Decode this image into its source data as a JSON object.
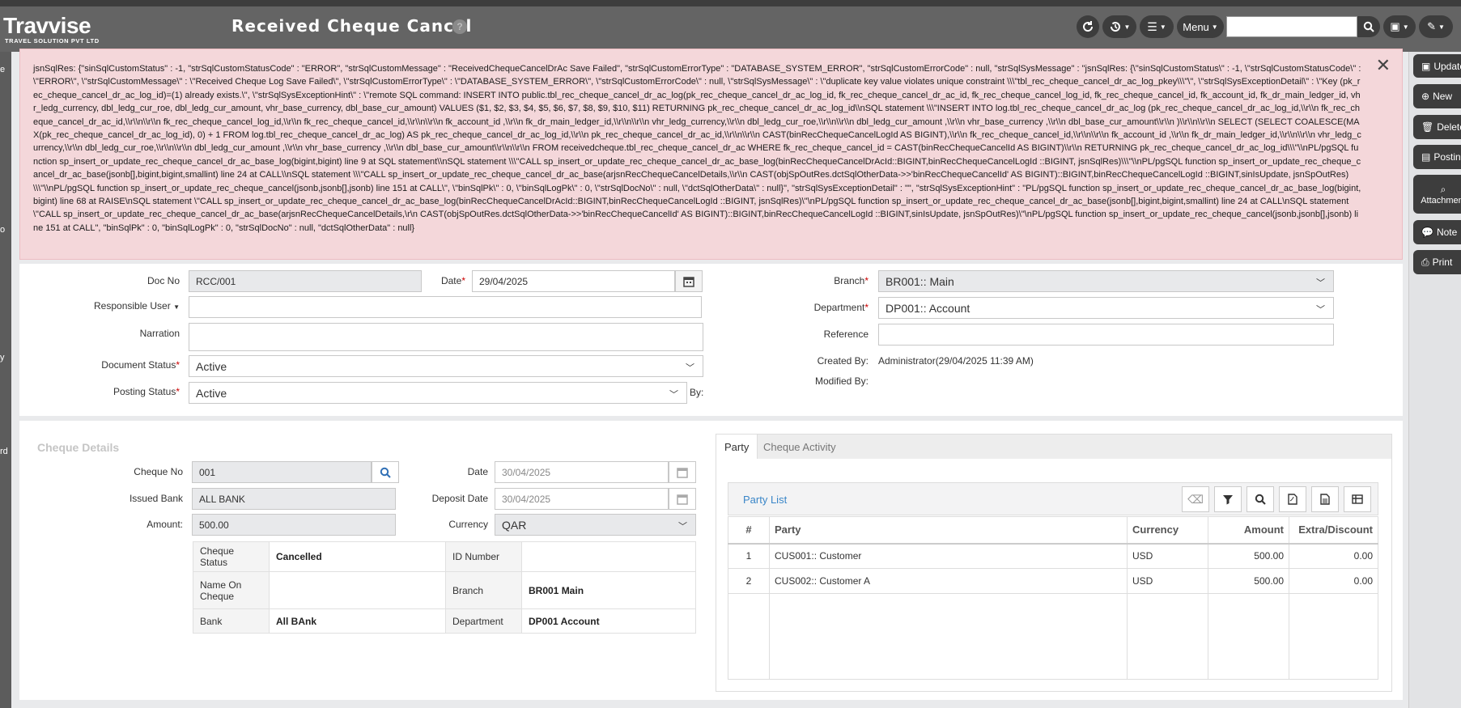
{
  "app": {
    "logo_main": "Travvise",
    "logo_sub": "TRAVEL SOLUTION PVT LTD"
  },
  "header": {
    "title": "Received Cheque Cancel",
    "help_icon": "?",
    "menu_label": "Menu",
    "search_placeholder": ""
  },
  "left_rail": {
    "items": [
      "e",
      "o",
      "y",
      "rd"
    ]
  },
  "right_rail": {
    "buttons": [
      {
        "label": "Update",
        "icon": "save-icon"
      },
      {
        "label": "New",
        "icon": "plus-icon"
      },
      {
        "label": "Delete",
        "icon": "trash-icon"
      },
      {
        "label": "Posting",
        "icon": "book-icon"
      },
      {
        "label": "Attachment",
        "icon": "paperclip-icon"
      },
      {
        "label": "Note",
        "icon": "comment-icon"
      },
      {
        "label": "Print",
        "icon": "print-icon"
      }
    ]
  },
  "error": {
    "message": "jsnSqlRes: {\"sinSqlCustomStatus\" : -1, \"strSqlCustomStatusCode\" : \"ERROR\", \"strSqlCustomMessage\" : \"ReceivedChequeCancelDrAc Save Failed\", \"strSqlCustomErrorType\" : \"DATABASE_SYSTEM_ERROR\", \"strSqlCustomErrorCode\" : null, \"strSqlSysMessage\" : \"jsnSqlRes: {\\\"sinSqlCustomStatus\\\" : -1, \\\"strSqlCustomStatusCode\\\" : \\\"ERROR\\\", \\\"strSqlCustomMessage\\\" : \\\"Received Cheque Log Save Failed\\\", \\\"strSqlCustomErrorType\\\" : \\\"DATABASE_SYSTEM_ERROR\\\", \\\"strSqlCustomErrorCode\\\" : null, \\\"strSqlSysMessage\\\" : \\\"duplicate key value violates unique constraint \\\\\\\"tbl_rec_cheque_cancel_dr_ac_log_pkey\\\\\\\"\\\", \\\"strSqlSysExceptionDetail\\\" : \\\"Key (pk_rec_cheque_cancel_dr_ac_log_id)=(1) already exists.\\\", \\\"strSqlSysExceptionHint\\\" : \\\"remote SQL command: INSERT INTO public.tbl_rec_cheque_cancel_dr_ac_log(pk_rec_cheque_cancel_dr_ac_log_id, fk_rec_cheque_cancel_dr_ac_id, fk_rec_cheque_cancel_log_id, fk_rec_cheque_cancel_id, fk_account_id, fk_dr_main_ledger_id, vhr_ledg_currency, dbl_ledg_cur_roe, dbl_ledg_cur_amount, vhr_base_currency, dbl_base_cur_amount) VALUES ($1, $2, $3, $4, $5, $6, $7, $8, $9, $10, $11) RETURNING pk_rec_cheque_cancel_dr_ac_log_id\\\\nSQL statement \\\\\\\"INSERT INTO log.tbl_rec_cheque_cancel_dr_ac_log (pk_rec_cheque_cancel_dr_ac_log_id,\\\\r\\\\n fk_rec_cheque_cancel_dr_ac_id,\\\\r\\\\n\\\\r\\\\n fk_rec_cheque_cancel_log_id,\\\\r\\\\n fk_rec_cheque_cancel_id,\\\\r\\\\n\\\\r\\\\n fk_account_id ,\\\\r\\\\n fk_dr_main_ledger_id,\\\\r\\\\n\\\\r\\\\n vhr_ledg_currency,\\\\r\\\\n dbl_ledg_cur_roe,\\\\r\\\\n\\\\r\\\\n dbl_ledg_cur_amount ,\\\\r\\\\n vhr_base_currency ,\\\\r\\\\n dbl_base_cur_amount\\\\r\\\\n )\\\\r\\\\n\\\\r\\\\n SELECT (SELECT COALESCE(MAX(pk_rec_cheque_cancel_dr_ac_log_id), 0) + 1 FROM log.tbl_rec_cheque_cancel_dr_ac_log) AS pk_rec_cheque_cancel_dr_ac_log_id,\\\\r\\\\n pk_rec_cheque_cancel_dr_ac_id,\\\\r\\\\n\\\\r\\\\n CAST(binRecChequeCancelLogId AS BIGINT),\\\\r\\\\n fk_rec_cheque_cancel_id,\\\\r\\\\n\\\\r\\\\n fk_account_id ,\\\\r\\\\n fk_dr_main_ledger_id,\\\\r\\\\n\\\\r\\\\n vhr_ledg_currency,\\\\r\\\\n dbl_ledg_cur_roe,\\\\r\\\\n\\\\r\\\\n dbl_ledg_cur_amount ,\\\\r\\\\n vhr_base_currency ,\\\\r\\\\n dbl_base_cur_amount\\\\r\\\\n\\\\r\\\\n FROM receivedcheque.tbl_rec_cheque_cancel_dr_ac WHERE fk_rec_cheque_cancel_id = CAST(binRecChequeCancelId AS BIGINT)\\\\r\\\\n RETURNING pk_rec_cheque_cancel_dr_ac_log_id\\\\\\\"\\\\nPL/pgSQL function sp_insert_or_update_rec_cheque_cancel_dr_ac_base_log(bigint,bigint) line 9 at SQL statement\\\\nSQL statement \\\\\\\"CALL sp_insert_or_update_rec_cheque_cancel_dr_ac_base_log(binRecChequeCancelDrAcId::BIGINT,binRecChequeCancelLogId ::BIGINT, jsnSqlRes)\\\\\\\"\\\\nPL/pgSQL function sp_insert_or_update_rec_cheque_cancel_dr_ac_base(jsonb[],bigint,bigint,smallint) line 24 at CALL\\\\nSQL statement \\\\\\\"CALL sp_insert_or_update_rec_cheque_cancel_dr_ac_base(arjsnRecChequeCancelDetails,\\\\r\\\\n CAST(objSpOutRes.dctSqlOtherData->>'binRecChequeCancelId' AS BIGINT)::BIGINT,binRecChequeCancelLogId ::BIGINT,sinIsUpdate, jsnSpOutRes)\\\\\\\"\\\\nPL/pgSQL function sp_insert_or_update_rec_cheque_cancel(jsonb,jsonb[],jsonb) line 151 at CALL\\\", \\\"binSqlPk\\\" : 0, \\\"binSqlLogPk\\\" : 0, \\\"strSqlDocNo\\\" : null, \\\"dctSqlOtherData\\\" : null}\", \"strSqlSysExceptionDetail\" : \"\", \"strSqlSysExceptionHint\" : \"PL/pgSQL function sp_insert_or_update_rec_cheque_cancel_dr_ac_base_log(bigint,bigint) line 68 at RAISE\\nSQL statement \\\"CALL sp_insert_or_update_rec_cheque_cancel_dr_ac_base_log(binRecChequeCancelDrAcId::BIGINT,binRecChequeCancelLogId ::BIGINT, jsnSqlRes)\\\"\\nPL/pgSQL function sp_insert_or_update_rec_cheque_cancel_dr_ac_base(jsonb[],bigint,bigint,smallint) line 24 at CALL\\nSQL statement \\\"CALL sp_insert_or_update_rec_cheque_cancel_dr_ac_base(arjsnRecChequeCancelDetails,\\r\\n CAST(objSpOutRes.dctSqlOtherData->>'binRecChequeCancelId' AS BIGINT)::BIGINT,binRecChequeCancelLogId ::BIGINT,sinIsUpdate, jsnSpOutRes)\\\"\\nPL/pgSQL function sp_insert_or_update_rec_cheque_cancel(jsonb,jsonb[],jsonb) line 151 at CALL\", \"binSqlPk\" : 0, \"binSqlLogPk\" : 0, \"strSqlDocNo\" : null, \"dctSqlOtherData\" : null}"
  },
  "form": {
    "doc_no_label": "Doc No",
    "doc_no": "RCC/001",
    "date_label": "Date",
    "date": "29/04/2025",
    "responsible_user_label": "Responsible User",
    "responsible_user": "",
    "narration_label": "Narration",
    "narration": "",
    "document_status_label": "Document Status",
    "document_status": "Active",
    "posting_status_label": "Posting Status",
    "posting_status": "Active",
    "by_label": "By:",
    "branch_label": "Branch",
    "branch": "BR001:: Main",
    "department_label": "Department",
    "department": "DP001:: Account",
    "reference_label": "Reference",
    "reference": "",
    "created_by_label": "Created By:",
    "created_by": "Administrator(29/04/2025 11:39 AM)",
    "modified_by_label": "Modified By:",
    "modified_by": ""
  },
  "cheque": {
    "section_title": "Cheque Details",
    "cheque_no_label": "Cheque No",
    "cheque_no": "001",
    "issued_bank_label": "Issued Bank",
    "issued_bank": "ALL BANK",
    "amount_label": "Amount:",
    "amount": "500.00",
    "date_label": "Date",
    "date": "30/04/2025",
    "deposit_date_label": "Deposit Date",
    "deposit_date": "30/04/2025",
    "currency_label": "Currency",
    "currency": "QAR",
    "info": {
      "cheque_status_label": "Cheque Status",
      "cheque_status": "Cancelled",
      "id_number_label": "ID Number",
      "id_number": "",
      "name_on_cheque_label": "Name On Cheque",
      "name_on_cheque": "",
      "branch_label": "Branch",
      "branch": "BR001 Main",
      "bank_label": "Bank",
      "bank": "All BAnk",
      "department_label": "Department",
      "department": "DP001 Account"
    }
  },
  "tabs": [
    {
      "label": "Party"
    },
    {
      "label": "Cheque Activity"
    }
  ],
  "party": {
    "title": "Party List",
    "columns": [
      "#",
      "Party",
      "Currency",
      "Amount",
      "Extra/Discount"
    ],
    "rows": [
      {
        "no": "1",
        "party": "CUS001:: Customer",
        "currency": "USD",
        "amount": "500.00",
        "extra": "0.00"
      },
      {
        "no": "2",
        "party": "CUS002:: Customer A",
        "currency": "USD",
        "amount": "500.00",
        "extra": "0.00"
      }
    ]
  }
}
